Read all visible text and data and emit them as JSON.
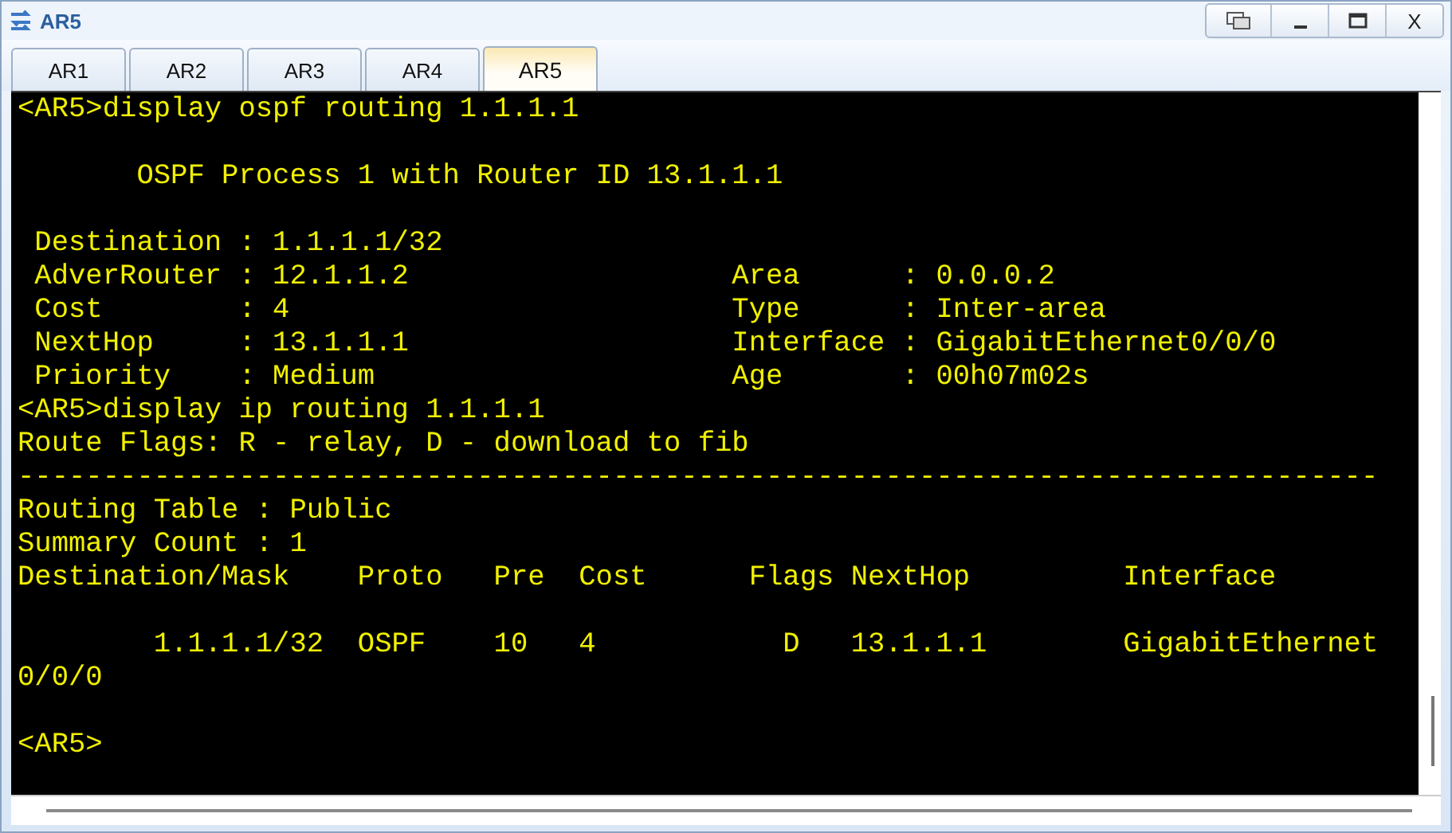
{
  "window": {
    "title": "AR5",
    "close_label": "X"
  },
  "tabs": [
    {
      "label": "AR1",
      "selected": false
    },
    {
      "label": "AR2",
      "selected": false
    },
    {
      "label": "AR3",
      "selected": false
    },
    {
      "label": "AR4",
      "selected": false
    },
    {
      "label": "AR5",
      "selected": true
    }
  ],
  "terminal": {
    "lines": [
      {
        "kind": "text",
        "text": "<AR5>display ospf routing 1.1.1.1"
      },
      {
        "kind": "blank"
      },
      {
        "kind": "text",
        "text": "       OSPF Process 1 with Router ID 13.1.1.1"
      },
      {
        "kind": "blank"
      },
      {
        "kind": "text",
        "text": " Destination : 1.1.1.1/32"
      },
      {
        "kind": "text",
        "text": " AdverRouter : 12.1.1.2                   Area      : 0.0.0.2"
      },
      {
        "kind": "text",
        "text": " Cost        : 4                          Type      : Inter-area"
      },
      {
        "kind": "text",
        "text": " NextHop     : 13.1.1.1                   Interface : GigabitEthernet0/0/0"
      },
      {
        "kind": "text",
        "text": " Priority    : Medium                     Age       : 00h07m02s"
      },
      {
        "kind": "text",
        "text": "<AR5>display ip routing 1.1.1.1"
      },
      {
        "kind": "text",
        "text": "Route Flags: R - relay, D - download to fib"
      },
      {
        "kind": "text",
        "text": "--------------------------------------------------------------------------------"
      },
      {
        "kind": "text",
        "text": "Routing Table : Public"
      },
      {
        "kind": "text",
        "text": "Summary Count : 1"
      },
      {
        "kind": "text",
        "text": "Destination/Mask    Proto   Pre  Cost      Flags NextHop         Interface"
      },
      {
        "kind": "blank"
      },
      {
        "kind": "text",
        "text": "        1.1.1.1/32  OSPF    10   4           D   13.1.1.1        GigabitEthernet"
      },
      {
        "kind": "text",
        "text": "0/0/0"
      },
      {
        "kind": "blank"
      },
      {
        "kind": "text",
        "text": "<AR5>"
      }
    ]
  }
}
